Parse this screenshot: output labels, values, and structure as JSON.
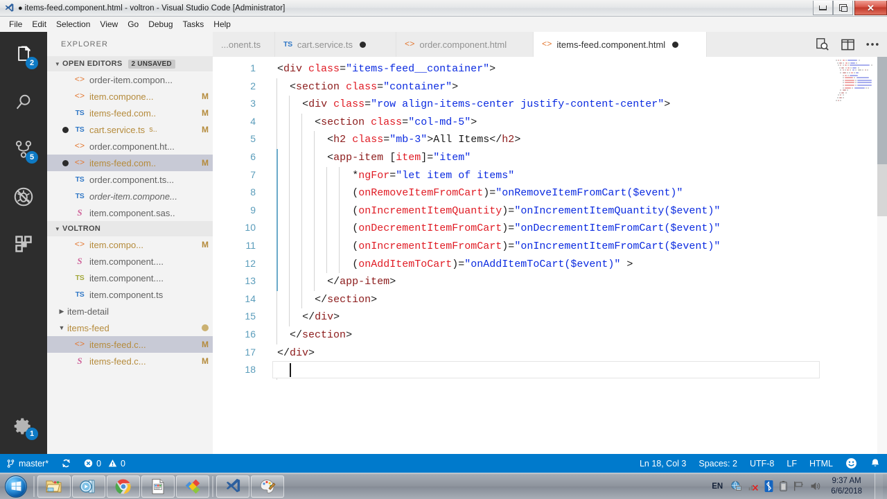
{
  "window": {
    "title": "items-feed.component.html - voltron - Visual Studio Code [Administrator]",
    "dirty_marker": "●",
    "app_icon": "vscode-icon",
    "controls": {
      "minimize": "minimize-icon",
      "restore": "restore-icon",
      "close": "✕"
    }
  },
  "menubar": {
    "items": [
      "File",
      "Edit",
      "Selection",
      "View",
      "Go",
      "Debug",
      "Tasks",
      "Help"
    ]
  },
  "activitybar": {
    "items": [
      {
        "name": "explorer",
        "icon": "files-icon",
        "badge": "2"
      },
      {
        "name": "search",
        "icon": "search-icon",
        "badge": ""
      },
      {
        "name": "source-control",
        "icon": "source-control-icon",
        "badge": "5"
      },
      {
        "name": "debug",
        "icon": "debug-no-icon",
        "badge": ""
      },
      {
        "name": "extensions",
        "icon": "extensions-icon",
        "badge": ""
      }
    ],
    "bottom": [
      {
        "name": "settings",
        "icon": "gear-icon",
        "badge": "1"
      }
    ]
  },
  "sidebar": {
    "title": "EXPLORER",
    "sections": [
      {
        "label": "OPEN EDITORS",
        "badge": "2 UNSAVED",
        "expanded": true,
        "rows": [
          {
            "dirty": false,
            "icon": "html",
            "name": "order-item.compon...",
            "desc": "",
            "badge": "",
            "selected": false,
            "italic": false,
            "modified": false
          },
          {
            "dirty": false,
            "icon": "html",
            "name": "item.compone...",
            "desc": "",
            "badge": "M",
            "selected": false,
            "italic": false,
            "modified": true
          },
          {
            "dirty": false,
            "icon": "ts",
            "name": "items-feed.com..",
            "desc": "",
            "badge": "M",
            "selected": false,
            "italic": false,
            "modified": true
          },
          {
            "dirty": true,
            "icon": "ts",
            "name": "cart.service.ts",
            "desc": "s..",
            "badge": "M",
            "selected": false,
            "italic": false,
            "modified": true
          },
          {
            "dirty": false,
            "icon": "html",
            "name": "order.component.ht...",
            "desc": "",
            "badge": "",
            "selected": false,
            "italic": false,
            "modified": false
          },
          {
            "dirty": true,
            "icon": "html",
            "name": "items-feed.com..",
            "desc": "",
            "badge": "M",
            "selected": true,
            "italic": false,
            "modified": true
          },
          {
            "dirty": false,
            "icon": "ts",
            "name": "order.component.ts...",
            "desc": "",
            "badge": "",
            "selected": false,
            "italic": false,
            "modified": false
          },
          {
            "dirty": false,
            "icon": "ts",
            "name": "order-item.compone...",
            "desc": "",
            "badge": "",
            "selected": false,
            "italic": true,
            "modified": false
          },
          {
            "dirty": false,
            "icon": "sass",
            "name": "item.component.sas..",
            "desc": "",
            "badge": "",
            "selected": false,
            "italic": false,
            "modified": false
          }
        ]
      },
      {
        "label": "VOLTRON",
        "badge": "",
        "expanded": true,
        "rows": [
          {
            "dirty": false,
            "icon": "html",
            "name": "item.compo...",
            "desc": "",
            "badge": "M",
            "selected": false,
            "italic": false,
            "modified": true
          },
          {
            "dirty": false,
            "icon": "sass",
            "name": "item.component....",
            "desc": "",
            "badge": "",
            "selected": false,
            "italic": false,
            "modified": false
          },
          {
            "dirty": false,
            "icon": "ts-dim",
            "name": "item.component....",
            "desc": "",
            "badge": "",
            "selected": false,
            "italic": false,
            "modified": false
          },
          {
            "dirty": false,
            "icon": "ts",
            "name": "item.component.ts",
            "desc": "",
            "badge": "",
            "selected": false,
            "italic": false,
            "modified": false
          },
          {
            "folder": true,
            "expanded": false,
            "name": "item-detail",
            "badge": ""
          },
          {
            "folder": true,
            "expanded": true,
            "name": "items-feed",
            "badge": "circle",
            "modified": true
          },
          {
            "dirty": false,
            "icon": "html",
            "name": "items-feed.c...",
            "desc": "",
            "badge": "M",
            "selected": true,
            "italic": false,
            "modified": true
          },
          {
            "dirty": false,
            "icon": "sass",
            "name": "items-feed.c...",
            "desc": "",
            "badge": "M",
            "selected": false,
            "italic": false,
            "modified": true
          }
        ]
      }
    ]
  },
  "tabs": [
    {
      "icon": "ts",
      "label": "...onent.ts",
      "dirty": false,
      "active": false
    },
    {
      "icon": "ts",
      "label": "cart.service.ts",
      "dirty": true,
      "active": false
    },
    {
      "icon": "html",
      "label": "order.component.html",
      "dirty": false,
      "active": false
    },
    {
      "icon": "html",
      "label": "items-feed.component.html",
      "dirty": true,
      "active": true
    }
  ],
  "tab_actions": [
    {
      "name": "open-preview-icon",
      "glyph": "preview"
    },
    {
      "name": "split-editor-icon",
      "glyph": "split"
    },
    {
      "name": "more-actions-icon",
      "glyph": "…"
    }
  ],
  "editor": {
    "language": "HTML",
    "lines": [
      {
        "n": "1",
        "indent": 0,
        "tokens": [
          [
            "punct",
            "<"
          ],
          [
            "tag",
            "div"
          ],
          [
            "text",
            " "
          ],
          [
            "attr",
            "class"
          ],
          [
            "punct",
            "="
          ],
          [
            "val",
            "\"items-feed__container\""
          ],
          [
            "punct",
            ">"
          ]
        ]
      },
      {
        "n": "2",
        "indent": 1,
        "tokens": [
          [
            "punct",
            "<"
          ],
          [
            "tag",
            "section"
          ],
          [
            "text",
            " "
          ],
          [
            "attr",
            "class"
          ],
          [
            "punct",
            "="
          ],
          [
            "val",
            "\"container\""
          ],
          [
            "punct",
            ">"
          ]
        ]
      },
      {
        "n": "3",
        "indent": 2,
        "tokens": [
          [
            "punct",
            "<"
          ],
          [
            "tag",
            "div"
          ],
          [
            "text",
            " "
          ],
          [
            "attr",
            "class"
          ],
          [
            "punct",
            "="
          ],
          [
            "val",
            "\"row align-items-center justify-content-center\""
          ],
          [
            "punct",
            ">"
          ]
        ]
      },
      {
        "n": "4",
        "indent": 3,
        "tokens": [
          [
            "punct",
            "<"
          ],
          [
            "tag",
            "section"
          ],
          [
            "text",
            " "
          ],
          [
            "attr",
            "class"
          ],
          [
            "punct",
            "="
          ],
          [
            "val",
            "\"col-md-5\""
          ],
          [
            "punct",
            ">"
          ]
        ]
      },
      {
        "n": "5",
        "indent": 4,
        "tokens": [
          [
            "punct",
            "<"
          ],
          [
            "tag",
            "h2"
          ],
          [
            "text",
            " "
          ],
          [
            "attr",
            "class"
          ],
          [
            "punct",
            "="
          ],
          [
            "val",
            "\"mb-3\""
          ],
          [
            "punct",
            ">"
          ],
          [
            "text",
            "All Items"
          ],
          [
            "punct",
            "</"
          ],
          [
            "tag",
            "h2"
          ],
          [
            "punct",
            ">"
          ]
        ]
      },
      {
        "n": "6",
        "indent": 4,
        "tokens": [
          [
            "punct",
            "<"
          ],
          [
            "tag",
            "app-item"
          ],
          [
            "text",
            " "
          ],
          [
            "punct",
            "["
          ],
          [
            "attr",
            "item"
          ],
          [
            "punct",
            "]="
          ],
          [
            "val",
            "\"item\""
          ]
        ]
      },
      {
        "n": "7",
        "indent": 6,
        "tokens": [
          [
            "punct",
            "*"
          ],
          [
            "attr",
            "ngFor"
          ],
          [
            "punct",
            "="
          ],
          [
            "val",
            "\"let item of items\""
          ]
        ]
      },
      {
        "n": "8",
        "indent": 6,
        "tokens": [
          [
            "punct",
            "("
          ],
          [
            "attr",
            "onRemoveItemFromCart"
          ],
          [
            "punct",
            ")="
          ],
          [
            "val",
            "\"onRemoveItemFromCart($event)\""
          ]
        ]
      },
      {
        "n": "9",
        "indent": 6,
        "tokens": [
          [
            "punct",
            "("
          ],
          [
            "attr",
            "onIncrementItemQuantity"
          ],
          [
            "punct",
            ")="
          ],
          [
            "val",
            "\"onIncrementItemQuantity($event)\""
          ]
        ]
      },
      {
        "n": "10",
        "indent": 6,
        "tokens": [
          [
            "punct",
            "("
          ],
          [
            "attr",
            "onDecrementItemFromCart"
          ],
          [
            "punct",
            ")="
          ],
          [
            "val",
            "\"onDecrementItemFromCart($event)\""
          ]
        ]
      },
      {
        "n": "11",
        "indent": 6,
        "tokens": [
          [
            "punct",
            "("
          ],
          [
            "attr",
            "onIncrementItemFromCart"
          ],
          [
            "punct",
            ")="
          ],
          [
            "val",
            "\"onIncrementItemFromCart($event)\""
          ]
        ]
      },
      {
        "n": "12",
        "indent": 6,
        "tokens": [
          [
            "punct",
            "("
          ],
          [
            "attr",
            "onAddItemToCart"
          ],
          [
            "punct",
            ")="
          ],
          [
            "val",
            "\"onAddItemToCart($event)\""
          ],
          [
            "text",
            " "
          ],
          [
            "punct",
            ">"
          ]
        ]
      },
      {
        "n": "13",
        "indent": 4,
        "tokens": [
          [
            "punct",
            "</"
          ],
          [
            "tag",
            "app-item"
          ],
          [
            "punct",
            ">"
          ]
        ]
      },
      {
        "n": "14",
        "indent": 3,
        "tokens": [
          [
            "punct",
            "</"
          ],
          [
            "tag",
            "section"
          ],
          [
            "punct",
            ">"
          ]
        ]
      },
      {
        "n": "15",
        "indent": 2,
        "tokens": [
          [
            "punct",
            "</"
          ],
          [
            "tag",
            "div"
          ],
          [
            "punct",
            ">"
          ]
        ]
      },
      {
        "n": "16",
        "indent": 1,
        "tokens": [
          [
            "punct",
            "</"
          ],
          [
            "tag",
            "section"
          ],
          [
            "punct",
            ">"
          ]
        ]
      },
      {
        "n": "17",
        "indent": 0,
        "tokens": [
          [
            "punct",
            "</"
          ],
          [
            "tag",
            "div"
          ],
          [
            "punct",
            ">"
          ]
        ]
      },
      {
        "n": "18",
        "indent": 1,
        "tokens": []
      }
    ]
  },
  "statusbar": {
    "branch": "master*",
    "sync_icon": "sync-icon",
    "errors": "0",
    "warnings": "0",
    "position": "Ln 18, Col 3",
    "indent": "Spaces: 2",
    "encoding": "UTF-8",
    "eol": "LF",
    "language": "HTML",
    "feedback_icon": "smiley-icon",
    "bell_icon": "bell-icon"
  },
  "taskbar": {
    "start": "start-orb",
    "buttons": [
      {
        "name": "explorer-taskbar-icon"
      },
      {
        "name": "media-player-taskbar-icon"
      },
      {
        "name": "chrome-taskbar-icon"
      },
      {
        "name": "document-taskbar-icon"
      },
      {
        "name": "diamonds-taskbar-icon"
      },
      {
        "name": "vscode-taskbar-icon"
      },
      {
        "name": "paint-taskbar-icon"
      }
    ],
    "tray": {
      "language": "EN",
      "icons": [
        "network-icon",
        "signal-muted-icon",
        "bluetooth-icon",
        "battery-icon",
        "flag-icon",
        "volume-icon"
      ],
      "time": "9:37 AM",
      "date": "6/6/2018"
    }
  },
  "colors": {
    "accent": "#007acc",
    "activitybar_bg": "#2d2d2d",
    "sidebar_bg": "#f3f3f3",
    "selection": "#c8cad6",
    "modified": "#b58b3c",
    "badge": "#0e7ac4"
  }
}
